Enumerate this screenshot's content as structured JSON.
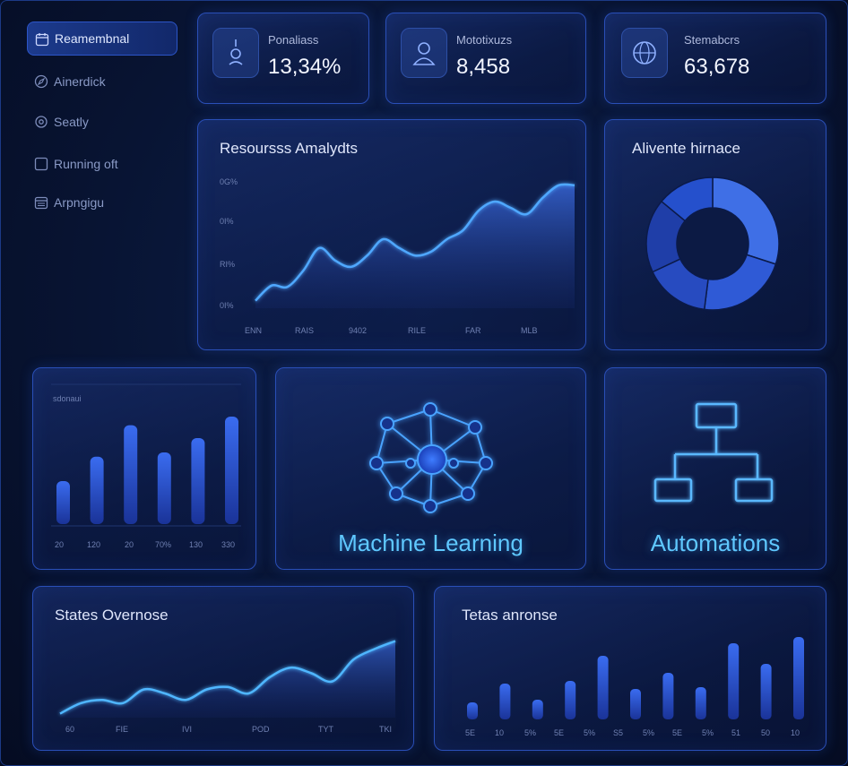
{
  "sidebar": {
    "items": [
      {
        "label": "Reamembnal",
        "icon": "calendar-icon",
        "active": true
      },
      {
        "label": "Ainerdick",
        "icon": "compass-icon",
        "active": false
      },
      {
        "label": "Seatly",
        "icon": "settings-icon",
        "active": false
      },
      {
        "label": "Running oft",
        "icon": "square-icon",
        "active": false
      },
      {
        "label": "Arpngigu",
        "icon": "calendar-icon",
        "active": false
      }
    ]
  },
  "stats": [
    {
      "label": "Ponaliass",
      "value": "13,34%",
      "icon": "location-pin-icon"
    },
    {
      "label": "Mototixuzs",
      "value": "8,458",
      "icon": "user-icon"
    },
    {
      "label": "Stemabcrs",
      "value": "63,678",
      "icon": "globe-icon"
    }
  ],
  "resources_panel": {
    "title": "Resoursss Amalydts",
    "y_ticks": [
      "0G%",
      "0I%",
      "RI%",
      "0I%"
    ],
    "x_ticks": [
      "ENN",
      "RAIS",
      "9402",
      "RILE",
      "FAR",
      "MLB"
    ]
  },
  "donut_panel": {
    "title": "Alivente hirnace"
  },
  "bar_panel_small": {
    "label": "sdonaui",
    "x_ticks": [
      "20",
      "120",
      "20",
      "70%",
      "130",
      "330"
    ]
  },
  "ml_panel": {
    "label": "Machine Learning",
    "icon": "neural-network-icon"
  },
  "automation_panel": {
    "label": "Automations",
    "icon": "flowchart-icon"
  },
  "states_panel": {
    "title": "States Overnose",
    "x_ticks": [
      "60",
      "FIE",
      "IVI",
      "POD",
      "TYT",
      "TKI"
    ]
  },
  "tetas_panel": {
    "title": "Tetas anronse",
    "x_ticks": [
      "5E",
      "10",
      "5%",
      "5E",
      "5%",
      "S5",
      "5%",
      "5E",
      "5%",
      "51",
      "50",
      "10"
    ]
  },
  "chart_data": [
    {
      "type": "area",
      "name": "resources",
      "ylim": [
        0,
        1
      ],
      "x": [
        0,
        1,
        2,
        3,
        4,
        5,
        6,
        7,
        8,
        9,
        10,
        11,
        12,
        13,
        14,
        15,
        16,
        17,
        18,
        19,
        20
      ],
      "values": [
        0.06,
        0.18,
        0.17,
        0.3,
        0.48,
        0.38,
        0.33,
        0.42,
        0.55,
        0.48,
        0.42,
        0.45,
        0.55,
        0.62,
        0.78,
        0.85,
        0.8,
        0.75,
        0.88,
        0.98,
        0.98
      ]
    },
    {
      "type": "pie",
      "name": "donut",
      "values": [
        30,
        22,
        16,
        18,
        14
      ],
      "colors": [
        "#3f6fe6",
        "#2f5ad6",
        "#274bc0",
        "#1f3ea8",
        "#2550cc"
      ]
    },
    {
      "type": "bar",
      "name": "small-bars",
      "values": [
        0.3,
        0.47,
        0.69,
        0.5,
        0.6,
        0.75
      ],
      "ylim": [
        0,
        1
      ]
    },
    {
      "type": "area",
      "name": "states",
      "ylim": [
        0,
        1
      ],
      "x": [
        0,
        1,
        2,
        3,
        4,
        5,
        6,
        7,
        8,
        9,
        10,
        11,
        12,
        13,
        14,
        15,
        16
      ],
      "values": [
        0.05,
        0.18,
        0.22,
        0.18,
        0.35,
        0.3,
        0.22,
        0.35,
        0.38,
        0.3,
        0.5,
        0.62,
        0.55,
        0.45,
        0.72,
        0.85,
        0.95
      ]
    },
    {
      "type": "bar",
      "name": "tetas-bars",
      "values": [
        0.19,
        0.4,
        0.22,
        0.43,
        0.71,
        0.34,
        0.52,
        0.36,
        0.85,
        0.62,
        0.92
      ],
      "ylim": [
        0,
        1
      ]
    }
  ]
}
